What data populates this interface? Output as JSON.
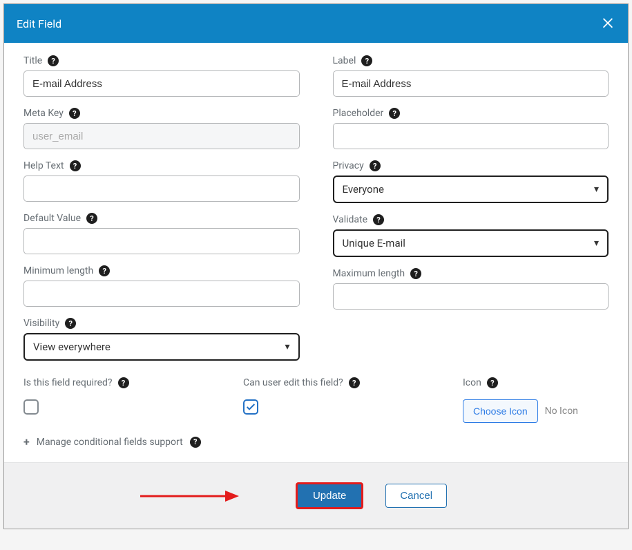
{
  "modal": {
    "title": "Edit Field",
    "close_label": "×"
  },
  "left": {
    "title_label": "Title",
    "title_value": "E-mail Address",
    "meta_label": "Meta Key",
    "meta_placeholder": "user_email",
    "help_label": "Help Text",
    "help_value": "",
    "default_label": "Default Value",
    "default_value": "",
    "min_label": "Minimum length",
    "min_value": "",
    "visibility_label": "Visibility",
    "visibility_value": "View everywhere"
  },
  "right": {
    "label_label": "Label",
    "label_value": "E-mail Address",
    "placeholder_label": "Placeholder",
    "placeholder_value": "",
    "privacy_label": "Privacy",
    "privacy_value": "Everyone",
    "validate_label": "Validate",
    "validate_value": "Unique E-mail",
    "max_label": "Maximum length",
    "max_value": ""
  },
  "bottom": {
    "required_label": "Is this field required?",
    "required_checked": false,
    "editable_label": "Can user edit this field?",
    "editable_checked": true,
    "icon_label": "Icon",
    "choose_icon_label": "Choose Icon",
    "no_icon_text": "No Icon",
    "conditional_label": "Manage conditional fields support"
  },
  "footer": {
    "update_label": "Update",
    "cancel_label": "Cancel"
  }
}
